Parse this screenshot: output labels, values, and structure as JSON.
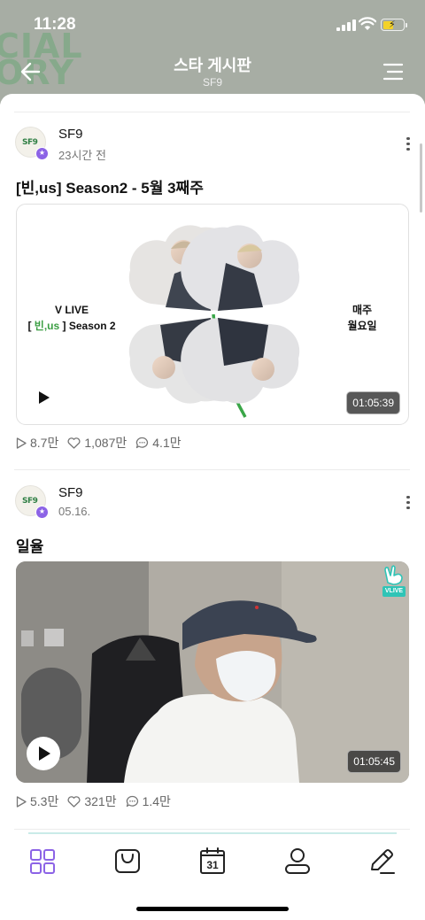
{
  "status_bar": {
    "time": "11:28"
  },
  "header": {
    "bg_words": [
      "CIAL",
      "ORY"
    ],
    "title": "스타 게시판",
    "subtitle": "SF9"
  },
  "posts": [
    {
      "author": "SF9",
      "avatar_logo": "SF9",
      "time": "23시간 전",
      "title": "[빈,us] Season2 - 5월 3째주",
      "promo_left_line1": "V LIVE",
      "promo_left_bracket_open": "[ ",
      "promo_left_highlight": "빈,us",
      "promo_left_rest": " ] Season 2",
      "promo_right_line1": "매주",
      "promo_right_line2": "월요일",
      "duration": "01:05:39",
      "plays": "8.7만",
      "likes": "1,087만",
      "comments": "4.1만"
    },
    {
      "author": "SF9",
      "avatar_logo": "SF9",
      "time": "05.16.",
      "title": "일율",
      "badge": "VLIVE",
      "duration": "01:05:45",
      "plays": "5.3만",
      "likes": "321만",
      "comments": "1.4만"
    }
  ],
  "colors": {
    "accent": "#8c63e6",
    "clover_green": "#3a9e42",
    "vlive_teal": "#2fc4b6"
  },
  "icons": {
    "back": "arrow-left-icon",
    "menu": "hamburger-menu-icon",
    "more": "more-vertical-icon",
    "play": "play-icon",
    "like": "heart-icon",
    "comment": "comment-icon",
    "nav": [
      "grid-icon",
      "shop-bag-icon",
      "calendar-icon",
      "profile-icon",
      "write-icon"
    ]
  },
  "nav": {
    "calendar_day": "31"
  }
}
